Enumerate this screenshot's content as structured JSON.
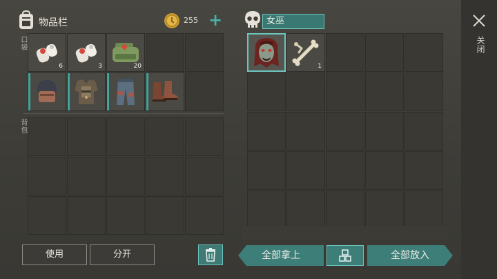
{
  "inventory": {
    "title": "物品栏",
    "coins": "255",
    "pocket_label": "口袋",
    "backpack_label": "背包",
    "pocket_slots": [
      {
        "icon": "bandage-icon",
        "qty": "6"
      },
      {
        "icon": "bandage-icon",
        "qty": "3"
      },
      {
        "icon": "medkit-icon",
        "qty": "20"
      },
      {
        "icon": "",
        "qty": ""
      },
      {
        "icon": "",
        "qty": ""
      },
      {
        "icon": "helmet-icon",
        "qty": "",
        "equip": true
      },
      {
        "icon": "armor-vest-icon",
        "qty": "",
        "equip": true
      },
      {
        "icon": "pants-icon",
        "qty": "",
        "equip": true
      },
      {
        "icon": "boots-icon",
        "qty": "",
        "equip": true
      },
      {
        "icon": "",
        "qty": ""
      }
    ],
    "use_label": "使用",
    "split_label": "分开"
  },
  "loot": {
    "title": "女巫",
    "slots": [
      {
        "icon": "witch-head-icon",
        "qty": "",
        "selected": true
      },
      {
        "icon": "bones-icon",
        "qty": "1"
      }
    ],
    "take_all_label": "全部拿上",
    "put_all_label": "全部放入"
  },
  "close_label": "关闭",
  "colors": {
    "accent": "#3d7e78",
    "accent_border": "#6cc4bc",
    "panel_bg": "#3f3e39"
  }
}
